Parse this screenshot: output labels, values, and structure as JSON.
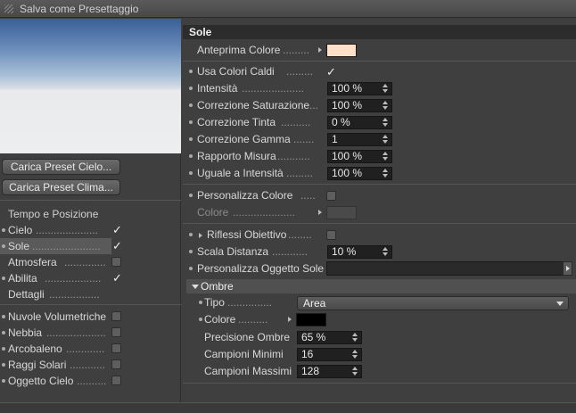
{
  "window": {
    "title": "Salva come Presettaggio"
  },
  "left": {
    "buttons": {
      "load_sky": "Carica Preset Cielo...",
      "load_climate": "Carica Preset Clima..."
    },
    "group_label": "Tempo e Posizione",
    "items": [
      {
        "label": "Cielo",
        "checked": true,
        "selected": false
      },
      {
        "label": "Sole",
        "checked": true,
        "selected": true
      },
      {
        "label": "Atmosfera",
        "checked": false,
        "selected": false
      },
      {
        "label": "Abilita",
        "checked": true,
        "selected": false
      },
      {
        "label": "Dettagli",
        "checked": null,
        "selected": false
      }
    ],
    "items2": [
      {
        "label": "Nuvole Volumetriche",
        "checked": false
      },
      {
        "label": "Nebbia",
        "checked": false
      },
      {
        "label": "Arcobaleno",
        "checked": false
      },
      {
        "label": "Raggi Solari",
        "checked": false
      },
      {
        "label": "Oggetto Cielo",
        "checked": false
      }
    ]
  },
  "right": {
    "section_title": "Sole",
    "preview_color": {
      "label": "Anteprima Colore",
      "color": "#ffe0c8"
    },
    "use_warm": {
      "label": "Usa Colori Caldi",
      "checked": true
    },
    "intensity": {
      "label": "Intensità",
      "value": "100 %"
    },
    "saturation": {
      "label": "Correzione Saturazione",
      "value": "100 %"
    },
    "tint": {
      "label": "Correzione Tinta",
      "value": "0 %"
    },
    "gamma": {
      "label": "Correzione Gamma",
      "value": "1"
    },
    "ratio": {
      "label": "Rapporto Misura",
      "value": "100 %"
    },
    "equal": {
      "label": "Uguale a Intensità",
      "value": "100 %"
    },
    "custom_color": {
      "label": "Personalizza Colore",
      "checked": false
    },
    "color": {
      "label": "Colore"
    },
    "lens_flare": {
      "label": "Riflessi Obiettivo",
      "checked": false
    },
    "distance_scale": {
      "label": "Scala Distanza",
      "value": "10 %"
    },
    "custom_sun_object": {
      "label": "Personalizza Oggetto Sole"
    },
    "shadows": {
      "title": "Ombre",
      "type": {
        "label": "Tipo",
        "value": "Area"
      },
      "color": {
        "label": "Colore",
        "color": "#000000"
      },
      "precision": {
        "label": "Precisione Ombre",
        "value": "65 %"
      },
      "min_samples": {
        "label": "Campioni Minimi",
        "value": "16"
      },
      "max_samples": {
        "label": "Campioni Massimi",
        "value": "128"
      }
    }
  }
}
